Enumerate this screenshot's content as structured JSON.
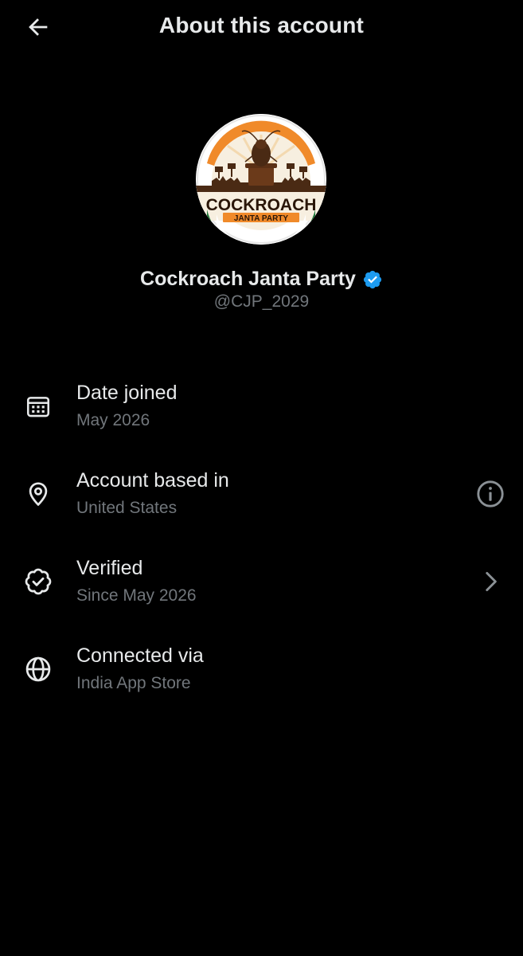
{
  "header": {
    "title": "About this account",
    "back_icon": "arrow-left-icon"
  },
  "profile": {
    "name": "Cockroach Janta Party",
    "handle": "@CJP_2029",
    "verified_badge_color": "#1d9bf0",
    "avatar_logo": {
      "line1": "COCKROACH",
      "line2": "JANTA PARTY",
      "colors": {
        "saffron": "#f08a2a",
        "green": "#1f7a3a",
        "brown": "#4a2a14",
        "cream": "#f7efe0"
      }
    }
  },
  "details": [
    {
      "icon": "calendar-icon",
      "title": "Date joined",
      "subtitle": "May 2026",
      "trailing_icon": null
    },
    {
      "icon": "location-pin-icon",
      "title": "Account based in",
      "subtitle": "United States",
      "trailing_icon": "info-icon"
    },
    {
      "icon": "verified-check-icon",
      "title": "Verified",
      "subtitle": "Since May 2026",
      "trailing_icon": "chevron-right-icon"
    },
    {
      "icon": "globe-icon",
      "title": "Connected via",
      "subtitle": "India App Store",
      "trailing_icon": null
    }
  ],
  "colors": {
    "background": "#000000",
    "primary_text": "#e7e9ea",
    "secondary_text": "#71767b"
  }
}
